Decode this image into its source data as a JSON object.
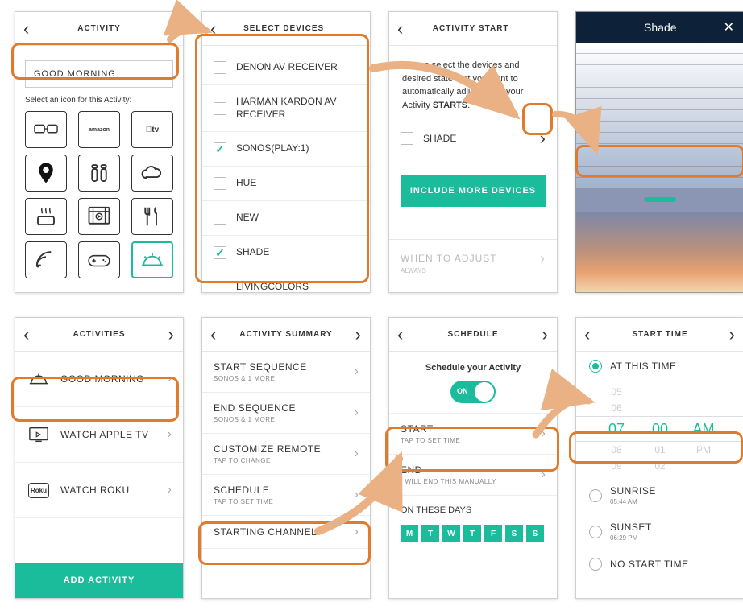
{
  "s1": {
    "title": "ACTIVITY",
    "activity_name": "GOOD MORNING",
    "icon_prompt": "Select an icon for this Activity:",
    "icons": [
      "3d-glasses",
      "amazon",
      "apple-tv",
      "location",
      "salt-pepper",
      "cloud",
      "cooking",
      "media",
      "cutlery",
      "satellite",
      "gamepad",
      "sunrise"
    ]
  },
  "s2": {
    "title": "SELECT DEVICES",
    "devices": [
      {
        "name": "DENON AV RECEIVER",
        "checked": false
      },
      {
        "name": "HARMAN KARDON AV RECEIVER",
        "checked": false
      },
      {
        "name": "SONOS(PLAY:1)",
        "checked": true
      },
      {
        "name": "HUE",
        "checked": false
      },
      {
        "name": "NEW",
        "checked": false
      },
      {
        "name": "SHADE",
        "checked": true
      },
      {
        "name": "LIVINGCOLORS",
        "checked": false
      }
    ]
  },
  "s3": {
    "title": "ACTIVITY START",
    "prompt_pre": "Please select the devices and desired state that you want to automatically adjust when your Activity ",
    "prompt_strong": "STARTS",
    "device": "SHADE",
    "include_btn": "INCLUDE MORE DEVICES",
    "when_header": "WHEN TO ADJUST",
    "when_sub": "ALWAYS"
  },
  "s4": {
    "title": "Shade"
  },
  "s5": {
    "title": "ACTIVITIES",
    "items": [
      {
        "name": "GOOD MORNING",
        "icon": "sunrise"
      },
      {
        "name": "WATCH APPLE TV",
        "icon": "appletv"
      },
      {
        "name": "WATCH ROKU",
        "icon": "roku"
      }
    ],
    "add_btn": "ADD ACTIVITY"
  },
  "s6": {
    "title": "ACTIVITY SUMMARY",
    "rows": [
      {
        "t": "START SEQUENCE",
        "s": "SONOS & 1 MORE"
      },
      {
        "t": "END SEQUENCE",
        "s": "SONOS & 1 MORE"
      },
      {
        "t": "CUSTOMIZE REMOTE",
        "s": "TAP TO CHANGE"
      },
      {
        "t": "SCHEDULE",
        "s": "TAP TO SET TIME"
      },
      {
        "t": "STARTING CHANNEL",
        "s": ""
      }
    ]
  },
  "s7": {
    "title": "SCHEDULE",
    "subtitle": "Schedule your Activity",
    "toggle": "ON",
    "start": {
      "t": "START",
      "s": "TAP TO SET TIME"
    },
    "end": {
      "t": "END",
      "s": "I WILL END THIS MANUALLY"
    },
    "days_label": "ON THESE DAYS",
    "days": [
      "M",
      "T",
      "W",
      "T",
      "F",
      "S",
      "S"
    ]
  },
  "s8": {
    "title": "START TIME",
    "opt1": "AT THIS TIME",
    "picker": {
      "prev2": {
        "h": "05",
        "m": ""
      },
      "prev": {
        "h": "06",
        "m": ""
      },
      "cur": {
        "h": "07",
        "m": "00",
        "ap": "AM"
      },
      "next": {
        "h": "08",
        "m": "01",
        "ap": "PM"
      },
      "next2": {
        "h": "09",
        "m": "02"
      }
    },
    "opt2": {
      "t": "SUNRISE",
      "s": "05:44 AM"
    },
    "opt3": {
      "t": "SUNSET",
      "s": "06:29 PM"
    },
    "opt4": {
      "t": "NO START TIME"
    }
  }
}
